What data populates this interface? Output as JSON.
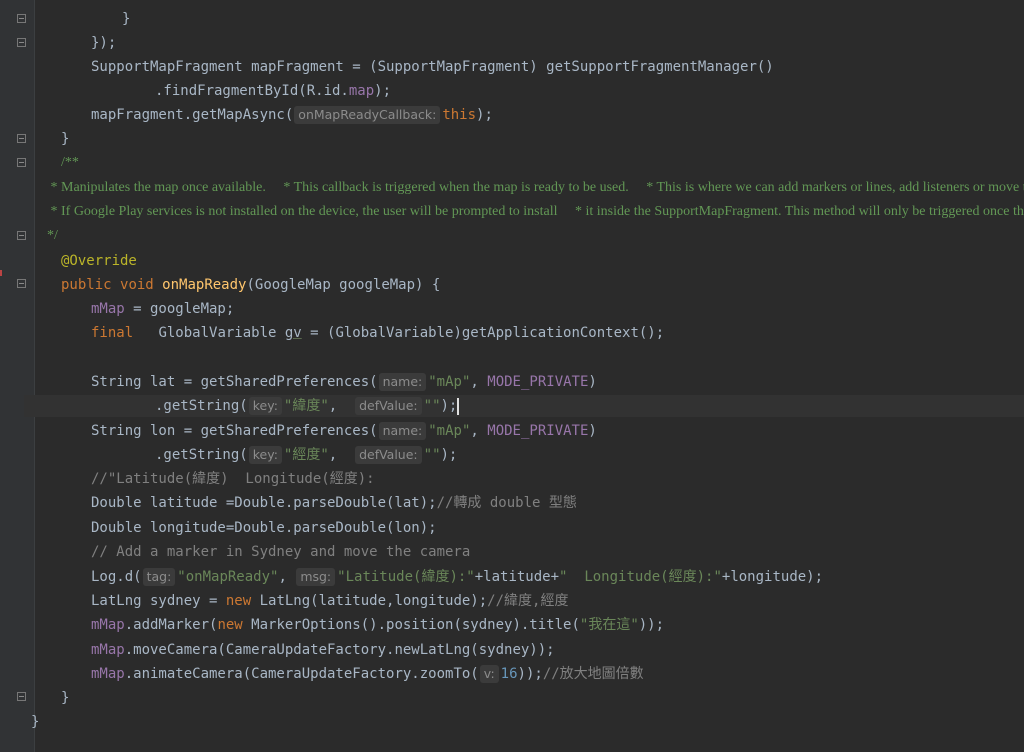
{
  "editor": {
    "lines": [
      {
        "id": "l0",
        "text": "    "
      },
      {
        "id": "l1",
        "text": "        }"
      },
      {
        "id": "l2",
        "text": "    });"
      },
      {
        "id": "l3",
        "text": "    SupportMapFragment mapFragment = (SupportMapFragment) getSupportFragmentManager()"
      },
      {
        "id": "l4",
        "text": "            .findFragmentById(R.id.map);"
      },
      {
        "id": "l5",
        "text": "    mapFragment.getMapAsync("
      },
      {
        "id": "l6",
        "text": "}"
      },
      {
        "id": "l7",
        "text": "/**"
      },
      {
        "id": "l8",
        "text": " * Manipulates the map once available.     * This callback is triggered when the map is ready to be used.     * This is where we can add markers or lines, add listeners or move the camera."
      },
      {
        "id": "l9",
        "text": " * If Google Play services is not installed on the device, the user will be prompted to install     * it inside the SupportMapFragment. This method will only be triggered once the user has"
      },
      {
        "id": "l10",
        "text": " */"
      },
      {
        "id": "l11",
        "text": "@Override"
      },
      {
        "id": "l12",
        "text": "public void onMapReady(GoogleMap googleMap) {"
      }
    ],
    "tokens": {
      "onMapReadyCallback_hint": "onMapReadyCallback:",
      "this": "this",
      "override": "@Override",
      "public": "public",
      "void": "void",
      "onMapReady": "onMapReady",
      "sig_rest": "(GoogleMap googleMap) {",
      "mMap": "mMap",
      "assign_googleMap": " = googleMap;",
      "final": "final",
      "global_decl": "   GlobalVariable ",
      "gv": "gv",
      "global_rest": " = (GlobalVariable)getApplicationContext();",
      "lat_decl": "String lat = getSharedPreferences(",
      "lon_decl": "String lon = getSharedPreferences(",
      "hint_name": "name:",
      "str_mAp": "\"mAp\"",
      "mode_private": "MODE_PRIVATE",
      "getString": ".getString(",
      "hint_key": "key:",
      "str_lat_key": "\"緯度\"",
      "hint_defValue": "defValue:",
      "str_empty": "\"\"",
      "str_lon_key": "\"經度\"",
      "comment_latlon": "//\"Latitude(緯度)  Longitude(經度):",
      "double_lat": "Double latitude =Double.parseDouble(lat);",
      "comment_convert": "//轉成 double 型態",
      "double_lon": "Double longitude=Double.parseDouble(lon);",
      "comment_sydney": "// Add a marker in Sydney and move the camera",
      "log_d": "Log.d(",
      "hint_tag": "tag:",
      "str_onMapReady": "\"onMapReady\"",
      "hint_msg": "msg:",
      "str_latitude": "\"Latitude(緯度):\"",
      "log_plus_lat": "+latitude+",
      "str_longitude": "\"  Longitude(經度):\"",
      "log_plus_lon": "+longitude);",
      "latlng_decl": "LatLng sydney = ",
      "new": "new",
      "latlng_rest": " LatLng(latitude,longitude);",
      "comment_latlng": "//緯度,經度",
      "addMarker": ".addMarker(",
      "markerOptions": " MarkerOptions().position(sydney).title(",
      "str_here": "\"我在這\"",
      "close2": "));",
      "moveCamera": ".moveCamera(CameraUpdateFactory.newLatLng(sydney));",
      "animateCamera": ".animateCamera(CameraUpdateFactory.zoomTo(",
      "hint_v": "v:",
      "num_16": "16",
      "close_zoom": "));",
      "comment_zoom": "//放大地圖倍數",
      "brace_close_inner": "}",
      "brace_close_outer": "}",
      "close_paren_semi": ");",
      "comma": ", ",
      "comma_only": ",",
      "semi": ");"
    }
  },
  "colors": {
    "background": "#2b2b2b",
    "keyword": "#cc7832",
    "method": "#ffc66d",
    "field": "#9876aa",
    "string": "#6a8759",
    "comment": "#808080",
    "javadoc": "#629755"
  }
}
